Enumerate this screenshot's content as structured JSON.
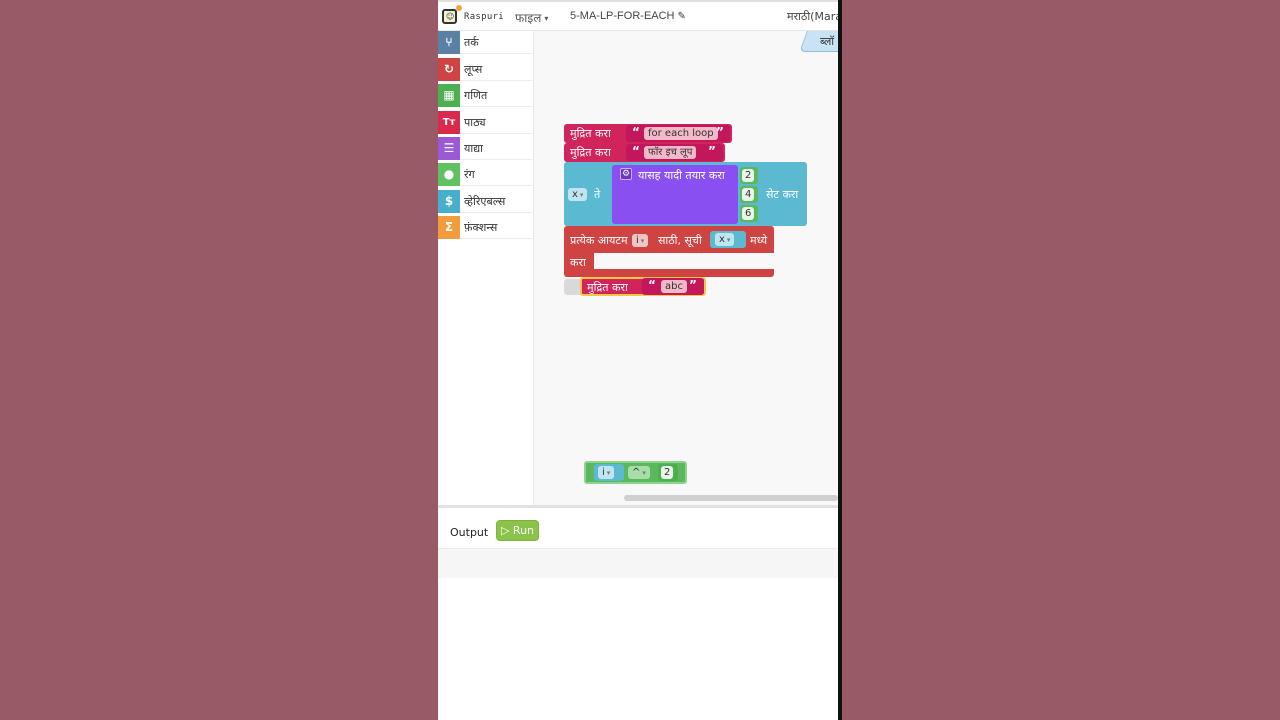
{
  "topbar": {
    "logo_face": "☺",
    "logo_text": "Raspuri",
    "file_menu": "फाइल",
    "file_caret": "▾",
    "project_name": "5-MA-LP-FOR-EACH",
    "pencil": "✎",
    "language": "मराठी(Mara"
  },
  "toolbox": {
    "categories": [
      {
        "label": "तर्क",
        "icon": "⑂",
        "color": "#5b80a5"
      },
      {
        "label": "लूप्स",
        "icon": "↻",
        "color": "#d04343"
      },
      {
        "label": "गणित",
        "icon": "▦",
        "color": "#4caf50"
      },
      {
        "label": "पाठ्य",
        "icon": "Tт",
        "color": "#d9294d"
      },
      {
        "label": "याद्या",
        "icon": "☰",
        "color": "#9b59d8"
      },
      {
        "label": "रंग",
        "icon": "●",
        "color": "#5fc15f"
      },
      {
        "label": "व्हेरिएबल्स",
        "icon": "$",
        "color": "#47afcc"
      },
      {
        "label": "फ़ंक्शन्स",
        "icon": "Σ",
        "color": "#f39c3c"
      }
    ]
  },
  "workspace": {
    "trash_tab": "ब्लॉ",
    "blocks": {
      "print1": {
        "label": "मुद्रित करा",
        "text": "for each loop"
      },
      "print2": {
        "label": "मुद्रित करा",
        "text": "फॉर इच लूप"
      },
      "set_block": {
        "var": "x",
        "to": "ते",
        "action": "सेट करा"
      },
      "list_block": {
        "label": "यासह यादी तयार करा",
        "items": [
          "2",
          "4",
          "6"
        ]
      },
      "foreach_block": {
        "label": "प्रत्येक आयटम",
        "var": "i",
        "for": "साठी, सूची",
        "list_var": "x",
        "in": "मध्ये",
        "do": "करा"
      },
      "print3": {
        "label": "मुद्रित करा",
        "text": "abc"
      },
      "math_block": {
        "left": "i",
        "op": "^",
        "right": "2"
      }
    },
    "open_quote": "“",
    "close_quote": "”",
    "gear": "⚙"
  },
  "output": {
    "label": "Output",
    "run_label": "▷ Run"
  }
}
